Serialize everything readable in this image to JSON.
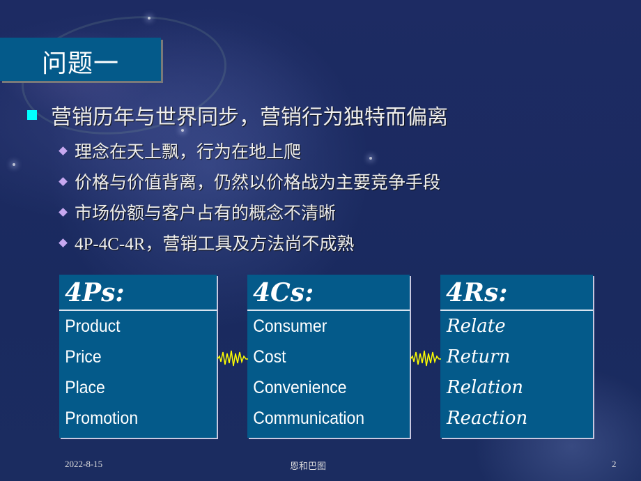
{
  "slide": {
    "title": "问题一",
    "main_bullet": "营销历年与世界同步，营销行为独特而偏离",
    "sub_bullets": [
      {
        "text": "理念在天上飘，行为在地上爬"
      },
      {
        "text": "价格与价值背离，仍然以价格战为主要竞争手段"
      },
      {
        "text": "市场份额与客户占有的概念不清晰"
      },
      {
        "latin": "4P-4C-4R",
        "text": "，营销工具及方法尚不成熟"
      }
    ],
    "cards": [
      {
        "heading": "4Ps:",
        "items": [
          "Product",
          "Price",
          "Place",
          "Promotion"
        ]
      },
      {
        "heading": "4Cs:",
        "items": [
          "Consumer",
          "Cost",
          "Convenience",
          "Communication"
        ]
      },
      {
        "heading": "4Rs:",
        "items": [
          "Relate",
          "Return",
          "Relation",
          "Reaction"
        ]
      }
    ],
    "connector_icon": "zigzag-wave-icon",
    "colors": {
      "background": "#1c2a62",
      "box": "#045a8a",
      "main_bullet": "#00ffff",
      "sub_bullet": "#c7a8f0",
      "connector": "#ffff00"
    }
  },
  "footer": {
    "date": "2022-8-15",
    "center": "恩和巴图",
    "page_number": "2"
  }
}
